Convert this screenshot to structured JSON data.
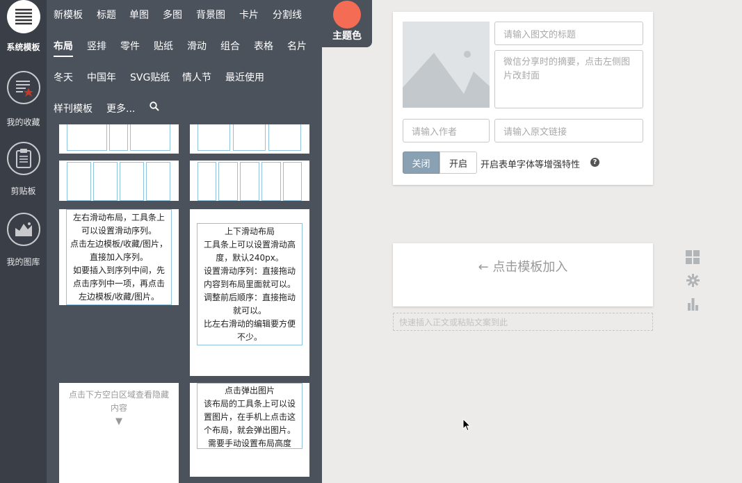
{
  "rail": {
    "system_templates": "系统模板",
    "favorites": "我的收藏",
    "clipboard": "剪贴板",
    "my_images": "我的图库"
  },
  "tabs": {
    "row1": [
      "新模板",
      "标题",
      "单图",
      "多图",
      "背景图",
      "卡片",
      "分割线"
    ],
    "row2": [
      "布局",
      "竖排",
      "零件",
      "贴纸",
      "滑动",
      "组合",
      "表格",
      "名片"
    ],
    "row3": [
      "冬天",
      "中国年",
      "SVG贴纸",
      "情人节",
      "最近使用"
    ],
    "row4": [
      "样刊模板",
      "更多..."
    ],
    "selected": "布局"
  },
  "theme": {
    "label": "主题色",
    "color": "#f56c54"
  },
  "templates": {
    "horizontal_slide": [
      "左右滑动布局，工具条上可以设置滑动序列。",
      "点击左边模板/收藏/图片，直接加入序列。",
      "如要插入到序列中间，先点击序列中一项，再点击左边模板/收藏/图片。"
    ],
    "vertical_slide": [
      "上下滑动布局",
      "工具条上可以设置滑动高度，默认240px。",
      "设置滑动序列：直接拖动内容到布局里面就可以。",
      "调整前后顺序：直接拖动就可以。",
      "比左右滑动的编辑要方便不少。"
    ],
    "hidden_content": "点击下方空白区域查看隐藏内容",
    "hidden_arrow": "▼",
    "popup_image": [
      "点击弹出图片",
      "该布局的工具条上可以设置图片，在手机上点击这个布局，就会弹出图片。",
      "需要手动设置布局高度"
    ]
  },
  "article": {
    "title_placeholder": "请输入图文的标题",
    "summary_placeholder": "微信分享时的摘要，点击左侧图片改封面",
    "author_placeholder": "请输入作者",
    "link_placeholder": "请输入原文链接",
    "off_label": "关闭",
    "on_label": "开启",
    "enhance_label": "开启表单字体等增强特性",
    "help": "?"
  },
  "editor": {
    "drop_hint": "← 点击模板加入",
    "paste_hint": "快速插入正文或粘贴文案到此"
  },
  "icons": [
    "menu-icon",
    "favorites-icon",
    "clipboard-icon",
    "image-library-icon",
    "search-icon",
    "grid-icon",
    "gear-icon",
    "bar-chart-icon",
    "cursor-icon"
  ]
}
